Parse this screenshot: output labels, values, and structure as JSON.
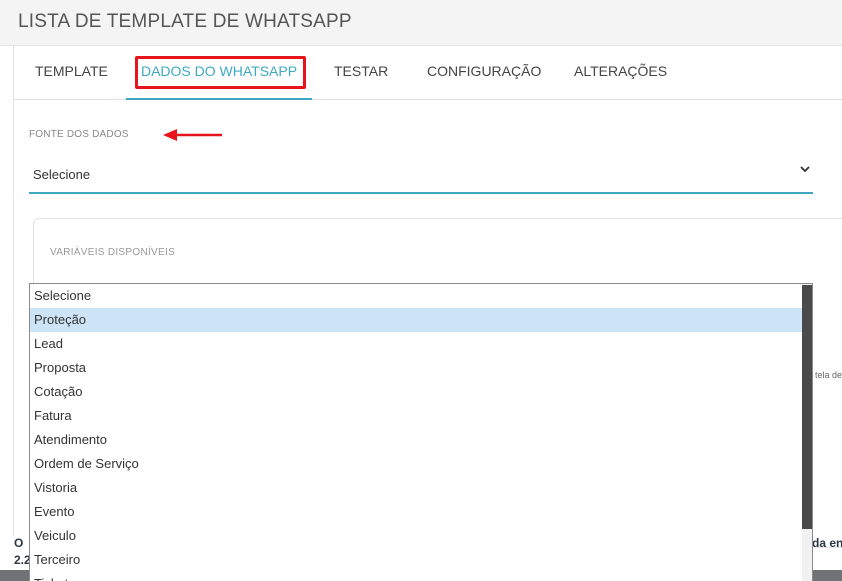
{
  "header": {
    "title": "LISTA DE TEMPLATE DE WHATSAPP"
  },
  "tabs": [
    {
      "label": "TEMPLATE"
    },
    {
      "label": "DADOS DO WHATSAPP"
    },
    {
      "label": "TESTAR"
    },
    {
      "label": "CONFIGURAÇÃO"
    },
    {
      "label": "ALTERAÇÕES"
    }
  ],
  "active_tab": "DADOS DO WHATSAPP",
  "source_field": {
    "label": "FONTE DOS DADOS",
    "value": "Selecione"
  },
  "variables_card": {
    "label": "VARIÁVEIS DISPONÍVEIS"
  },
  "partial_texts": {
    "side": "tela de",
    "footer_left_1": "O",
    "footer_left_2": "2.2",
    "footer_right": "da en"
  },
  "dropdown": {
    "hovered": "Proteção",
    "options": [
      "Selecione",
      "Proteção",
      "Lead",
      "Proposta",
      "Cotação",
      "Fatura",
      "Atendimento",
      "Ordem de Serviço",
      "Vistoria",
      "Evento",
      "Veiculo",
      "Terceiro",
      "Tickets"
    ]
  },
  "colors": {
    "accent": "#3fa9c1",
    "annotation": "#e8141b",
    "hover": "#cde3f6"
  }
}
